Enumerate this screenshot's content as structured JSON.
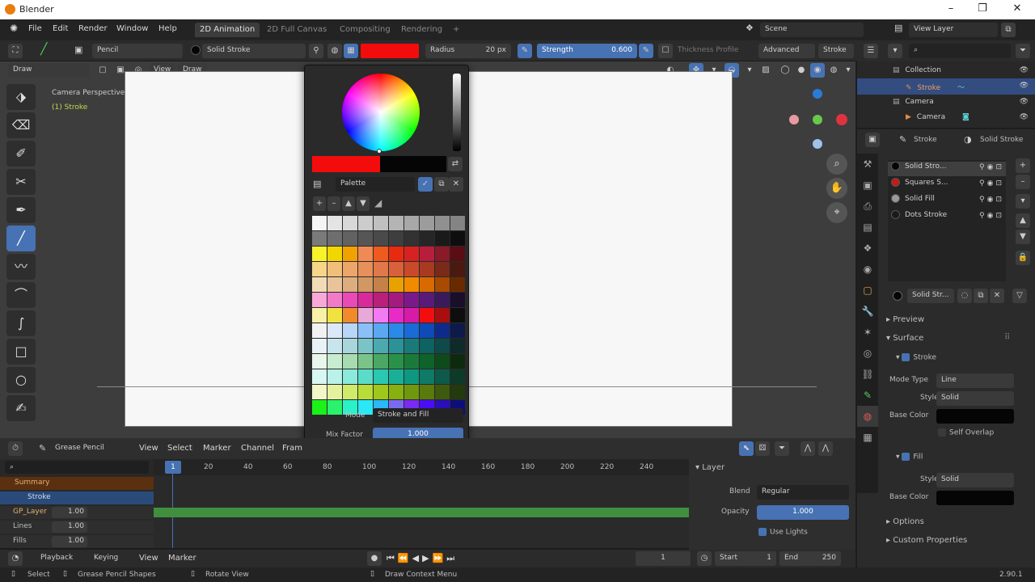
{
  "window": {
    "title": "Blender",
    "min": "–",
    "max": "❐",
    "close": "✕"
  },
  "menu": [
    "File",
    "Edit",
    "Render",
    "Window",
    "Help"
  ],
  "workspaces": [
    {
      "label": "2D Animation",
      "active": true
    },
    {
      "label": "2D Full Canvas",
      "active": false
    },
    {
      "label": "Compositing",
      "active": false
    },
    {
      "label": "Rendering",
      "active": false
    },
    {
      "label": "+",
      "active": false
    }
  ],
  "scene": "Scene",
  "view_layer": "View Layer",
  "tool_header": {
    "brush": "Pencil",
    "material": "Solid Stroke",
    "color": "#f30c0c",
    "radius_label": "Radius",
    "radius_value": "20 px",
    "strength_label": "Strength",
    "strength_value": "0.600",
    "thickness_profile": "Thickness Profile",
    "advanced": "Advanced",
    "stroke": "Stroke"
  },
  "viewport": {
    "mode": "Draw",
    "view": "View",
    "draw": "Draw",
    "camera_perspective": "Camera Perspective",
    "object_name": "(1) Stroke"
  },
  "popup": {
    "palette_name": "Palette",
    "mode_label": "Mode",
    "mode_value": "Stroke and Fill",
    "mix_factor_label": "Mix Factor",
    "mix_factor_value": "1.000",
    "new_color": "#f30c0c",
    "old_color": "#050505",
    "palette_colors": [
      "#f4f4f4",
      "#e4e4e4",
      "#d8d8d8",
      "#cccccc",
      "#c0c0c0",
      "#b4b4b4",
      "#a8a8a8",
      "#9c9c9c",
      "#909090",
      "#848484",
      "#7a7a7a",
      "#6e6e6e",
      "#626262",
      "#565656",
      "#4a4a4a",
      "#3e3e3e",
      "#323232",
      "#262626",
      "#1a1a1a",
      "#0e0e0e",
      "#f7f22a",
      "#f2d600",
      "#f2a200",
      "#ef8a55",
      "#ef5a1e",
      "#e82a0f",
      "#d8221f",
      "#b81e3c",
      "#8a1a28",
      "#5a0e14",
      "#f7d68a",
      "#f0c07a",
      "#eda66a",
      "#e8905a",
      "#e0784a",
      "#d8603a",
      "#c84a2a",
      "#a83a22",
      "#7a2a18",
      "#4a1a10",
      "#f2dcb8",
      "#e8c49a",
      "#dcae7e",
      "#d09862",
      "#c48248",
      "#e8a200",
      "#f28a00",
      "#d86a00",
      "#a84a00",
      "#6a2a00",
      "#f7a8d8",
      "#f27ac8",
      "#ea4ab8",
      "#d82a9a",
      "#b8207a",
      "#a41a7e",
      "#7a1a8a",
      "#5a1a7a",
      "#3a1a5a",
      "#1a0e2a",
      "#f7f2a8",
      "#f2e240",
      "#f28a2a",
      "#e8a8d8",
      "#f27af2",
      "#e82ac8",
      "#d81aa8",
      "#f20e0e",
      "#a80e0e",
      "#0e0e0e",
      "#f2f2f2",
      "#dce8f7",
      "#b8d6f7",
      "#8ac0f7",
      "#5aa8f2",
      "#2a8ae8",
      "#1a6ad8",
      "#0e4ab8",
      "#0e2a8a",
      "#0e1a4a",
      "#e8f2f7",
      "#c8e4ec",
      "#a8d6dc",
      "#7ac4c8",
      "#4aaab0",
      "#2a9298",
      "#1a7a7a",
      "#0e6262",
      "#0e4a4a",
      "#0e2a2a",
      "#e8f7ec",
      "#c8ecd0",
      "#a8dcb0",
      "#7ac48a",
      "#4aa864",
      "#2a9248",
      "#1a7a3a",
      "#0e622a",
      "#0e4a1a",
      "#0e2a0e",
      "#d8f7f2",
      "#b8f2e8",
      "#8aeadc",
      "#5adcc8",
      "#2ac8b0",
      "#1ab098",
      "#0e9880",
      "#0e7a68",
      "#0e5a4a",
      "#0e3a2a",
      "#f2f7c8",
      "#e4f2a0",
      "#d0ea6a",
      "#b8dc3a",
      "#a0c81a",
      "#88b00e",
      "#70980e",
      "#5a7a0e",
      "#3e5a0e",
      "#223a0e",
      "#1af21a",
      "#2af26a",
      "#2af2c8",
      "#2ae8f7",
      "#2ab8f7",
      "#7a6af2",
      "#7a2af2",
      "#4a0ef2",
      "#2a0eb8",
      "#0e0e7a"
    ]
  },
  "outliner": {
    "items": [
      {
        "label": "Collection"
      },
      {
        "label": "Stroke"
      },
      {
        "label": "Camera"
      },
      {
        "label": "Camera"
      }
    ]
  },
  "properties": {
    "object": "Stroke",
    "material_header": "Solid Stroke",
    "slots": [
      "Solid Stro...",
      "Squares S...",
      "Solid Fill",
      "Dots Stroke"
    ],
    "slot_colors": [
      "#050505",
      "#c41a1a",
      "#9a9a9a",
      "#1a1a1a"
    ],
    "material_field": "Solid Str...",
    "preview": "Preview",
    "surface": "Surface",
    "stroke_section": "Stroke",
    "mode_type_label": "Mode Type",
    "mode_type_value": "Line",
    "style_label": "Style",
    "style_value": "Solid",
    "base_color_label": "Base Color",
    "self_overlap": "Self Overlap",
    "fill_section": "Fill",
    "fill_style_label": "Style",
    "fill_style_value": "Solid",
    "fill_base_color_label": "Base Color",
    "options": "Options",
    "custom_properties": "Custom Properties"
  },
  "timeline_header": {
    "editor": "Grease Pencil",
    "menus": [
      "View",
      "Select",
      "Marker",
      "Channel",
      "Fram"
    ]
  },
  "timeline": {
    "current_frame": "1",
    "ticks": [
      "20",
      "40",
      "60",
      "80",
      "100",
      "120",
      "140",
      "160",
      "180",
      "200",
      "220",
      "240"
    ],
    "channels": [
      {
        "label": "Summary"
      },
      {
        "label": "Stroke"
      },
      {
        "label": "GP_Layer",
        "value": "1.00"
      },
      {
        "label": "Lines",
        "value": "1.00"
      },
      {
        "label": "Fills",
        "value": "1.00"
      }
    ]
  },
  "layer_panel": {
    "title": "Layer",
    "blend_label": "Blend",
    "blend_value": "Regular",
    "opacity_label": "Opacity",
    "opacity_value": "1.000",
    "use_lights": "Use Lights"
  },
  "playbar": {
    "playback": "Playback",
    "keying": "Keying",
    "view": "View",
    "marker": "Marker",
    "frame": "1",
    "start_label": "Start",
    "start_value": "1",
    "end_label": "End",
    "end_value": "250"
  },
  "status": {
    "select": "Select",
    "grease_pencil_shapes": "Grease Pencil Shapes",
    "rotate_view": "Rotate View",
    "context_menu": "Draw Context Menu",
    "version": "2.90.1"
  }
}
